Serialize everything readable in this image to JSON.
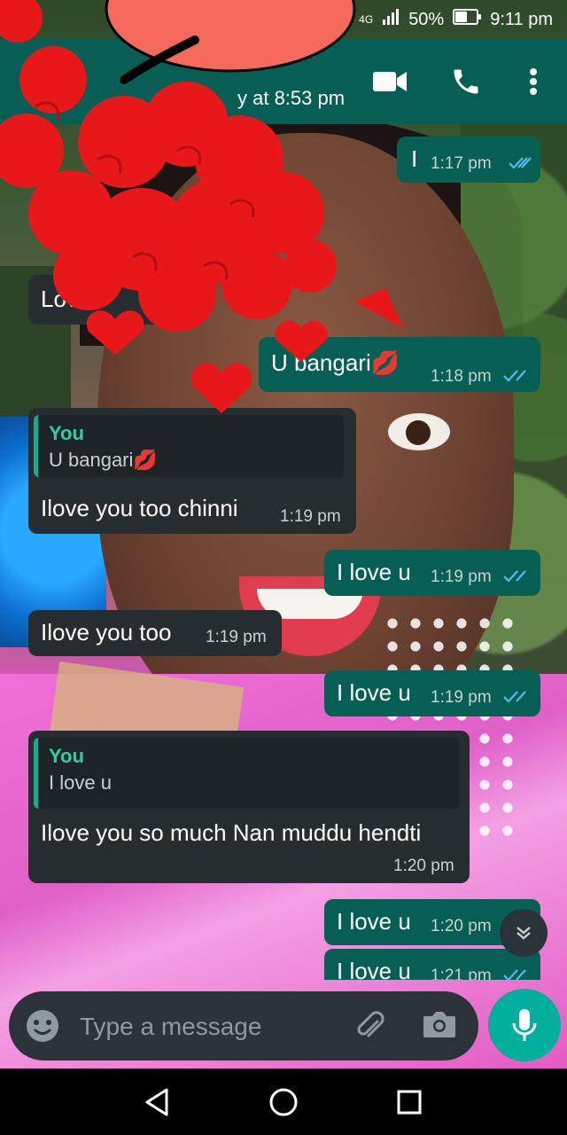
{
  "status_bar": {
    "network": "4G",
    "battery": "50%",
    "time": "9:11 pm"
  },
  "header": {
    "last_seen": "y at 8:53 pm",
    "video_call_icon": "video-camera-icon",
    "voice_call_icon": "phone-icon",
    "menu_icon": "more-vert-icon"
  },
  "messages": [
    {
      "dir": "out",
      "text": "I",
      "time": "1:17 pm",
      "ticks": "read"
    },
    {
      "dir": "in",
      "text": "Love",
      "time": "",
      "note": "partially covered by sticker"
    },
    {
      "dir": "out",
      "text": "U bangari💋",
      "time": "1:18 pm",
      "ticks": "read"
    },
    {
      "dir": "in",
      "quote_author": "You",
      "quote_text": "U bangari💋",
      "text": "Ilove you too chinni",
      "time": "1:19 pm"
    },
    {
      "dir": "out",
      "text": "I love u",
      "time": "1:19 pm",
      "ticks": "read"
    },
    {
      "dir": "in",
      "text": "Ilove you too",
      "time": "1:19 pm"
    },
    {
      "dir": "out",
      "text": "I love u",
      "time": "1:19 pm",
      "ticks": "read"
    },
    {
      "dir": "in",
      "quote_author": "You",
      "quote_text": "I love u",
      "text": "Ilove you so much Nan muddu hendti",
      "time": "1:20 pm"
    },
    {
      "dir": "out",
      "text": "I love u",
      "time": "1:20 pm",
      "ticks": "read"
    },
    {
      "dir": "out",
      "text": "I love u",
      "time": "1:21 pm",
      "ticks": "read"
    }
  ],
  "composer": {
    "placeholder": "Type a message",
    "emoji_icon": "emoji-icon",
    "attach_icon": "paperclip-icon",
    "camera_icon": "camera-icon",
    "mic_icon": "mic-icon"
  },
  "colors": {
    "header": "#075e54",
    "outgoing_bubble": "#075e54",
    "incoming_bubble": "#262d31",
    "accent": "#00af9c",
    "read_tick": "#53bdeb"
  }
}
